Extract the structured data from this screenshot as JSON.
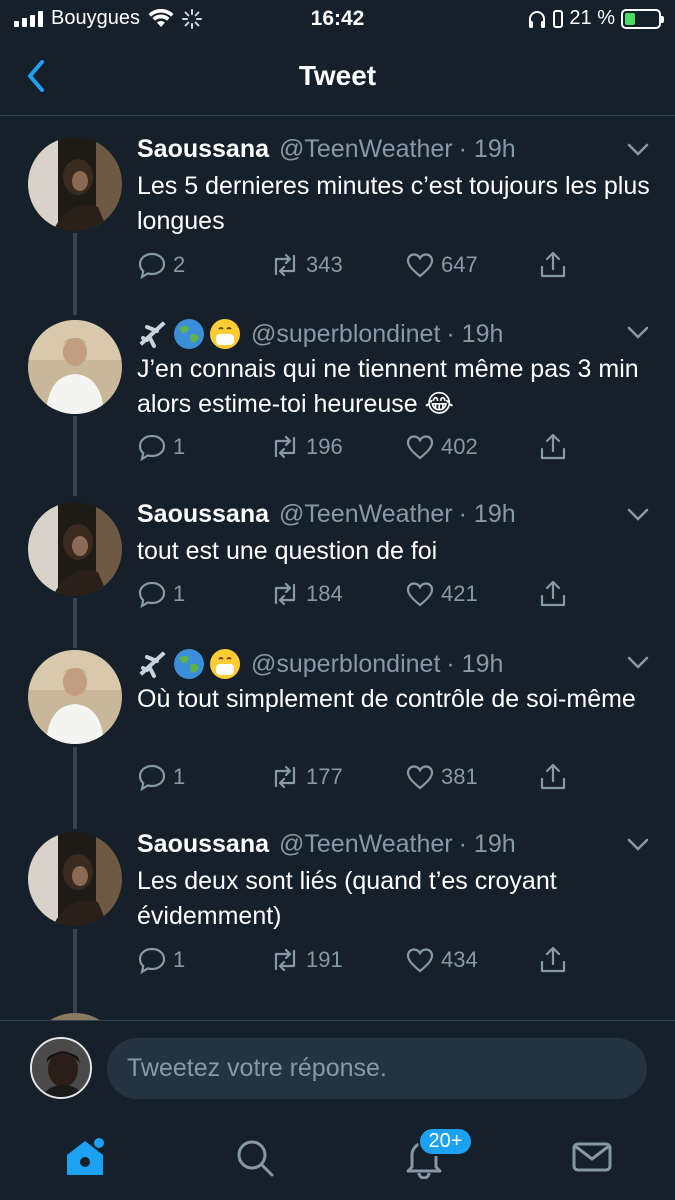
{
  "status_bar": {
    "carrier": "Bouygues",
    "time": "16:42",
    "battery": "21 %"
  },
  "header": {
    "title": "Tweet",
    "back_icon": "chevron-left-icon"
  },
  "tweets": [
    {
      "author_name": "Saoussana",
      "handle": "@TeenWeather",
      "time": "· 19h",
      "text": "Les 5 dernieres minutes c’est toujours les plus longues",
      "replies": "2",
      "retweets": "343",
      "likes": "647"
    },
    {
      "author_name": "",
      "emojis": [
        "airplane",
        "globe",
        "mask"
      ],
      "handle": "@superblondinet",
      "time": "· 19h",
      "text": "J’en connais qui ne tiennent même pas 3 min alors estime-toi heureuse 😂",
      "replies": "1",
      "retweets": "196",
      "likes": "402"
    },
    {
      "author_name": "Saoussana",
      "handle": "@TeenWeather",
      "time": "· 19h",
      "text": "tout est une question de foi",
      "replies": "1",
      "retweets": "184",
      "likes": "421"
    },
    {
      "author_name": "",
      "emojis": [
        "airplane",
        "globe",
        "mask"
      ],
      "handle": "@superblondinet",
      "time": "· 19h",
      "text": "Où tout simplement de contrôle de soi-même",
      "replies": "1",
      "retweets": "177",
      "likes": "381"
    },
    {
      "author_name": "Saoussana",
      "handle": "@TeenWeather",
      "time": "· 19h",
      "text": "Les deux sont liés (quand t’es croyant évidemment)",
      "replies": "1",
      "retweets": "191",
      "likes": "434"
    }
  ],
  "reply": {
    "placeholder": "Tweetez votre réponse."
  },
  "tab_bar": {
    "items": [
      "home-icon",
      "search-icon",
      "notifications-icon",
      "messages-icon"
    ],
    "notifications_badge": "20+"
  },
  "colors": {
    "background": "#15202b",
    "accent": "#1da1f2",
    "muted_text": "#8899a6",
    "divider": "#38444d"
  }
}
